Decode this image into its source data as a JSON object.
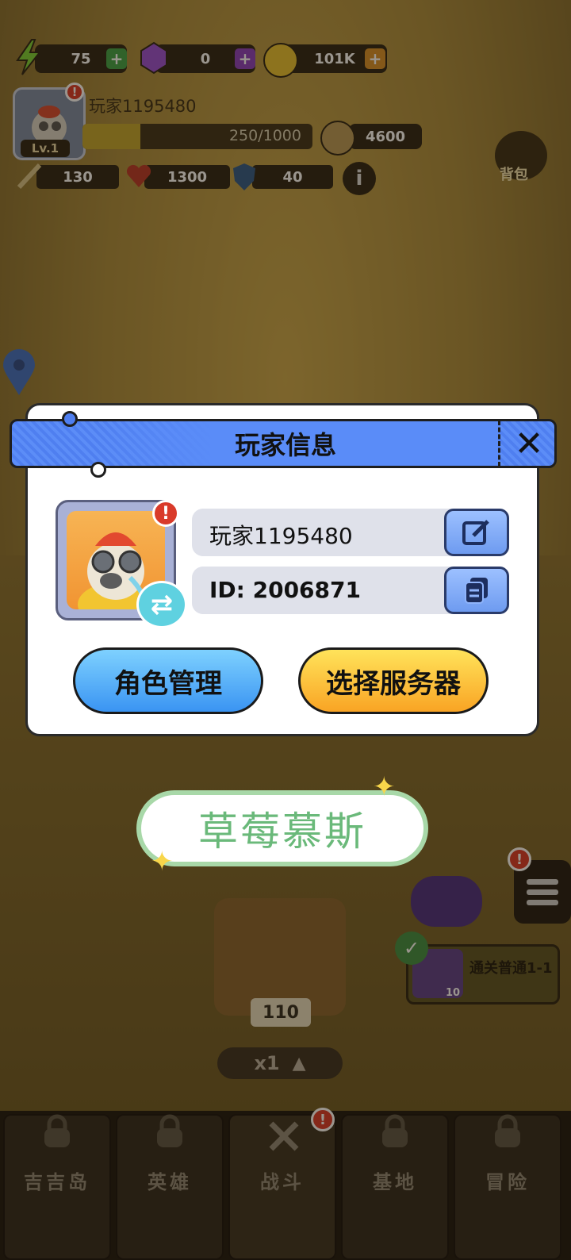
{
  "hud": {
    "energy": "75",
    "gems": "0",
    "coins": "101K",
    "player_name": "玩家1195480",
    "level": "Lv.1",
    "xp": "250/1000",
    "xp_progress": 0.25,
    "power": "4600",
    "attack": "130",
    "hp": "1300",
    "defense": "40",
    "bag_label": "背包"
  },
  "modal": {
    "title": "玩家信息",
    "player_name": "玩家1195480",
    "player_id": "ID: 2006871",
    "role_button": "角色管理",
    "server_button": "选择服务器"
  },
  "toast": {
    "text": "草莓慕斯"
  },
  "battle": {
    "box_count": "110",
    "speed": "x1",
    "quest_reward": "10",
    "quest_text": "通关普通1-1"
  },
  "nav": {
    "tabs": [
      {
        "label": "吉吉岛",
        "icon": "lock-icon"
      },
      {
        "label": "英雄",
        "icon": "lock-icon"
      },
      {
        "label": "战斗",
        "icon": "crossed-swords-icon"
      },
      {
        "label": "基地",
        "icon": "lock-icon"
      },
      {
        "label": "冒险",
        "icon": "lock-icon"
      }
    ]
  },
  "colors": {
    "modal_header": "#5a8cf8",
    "role_button": "#3a94f2",
    "server_button": "#f9a424",
    "toast_text": "#6ab97a"
  }
}
